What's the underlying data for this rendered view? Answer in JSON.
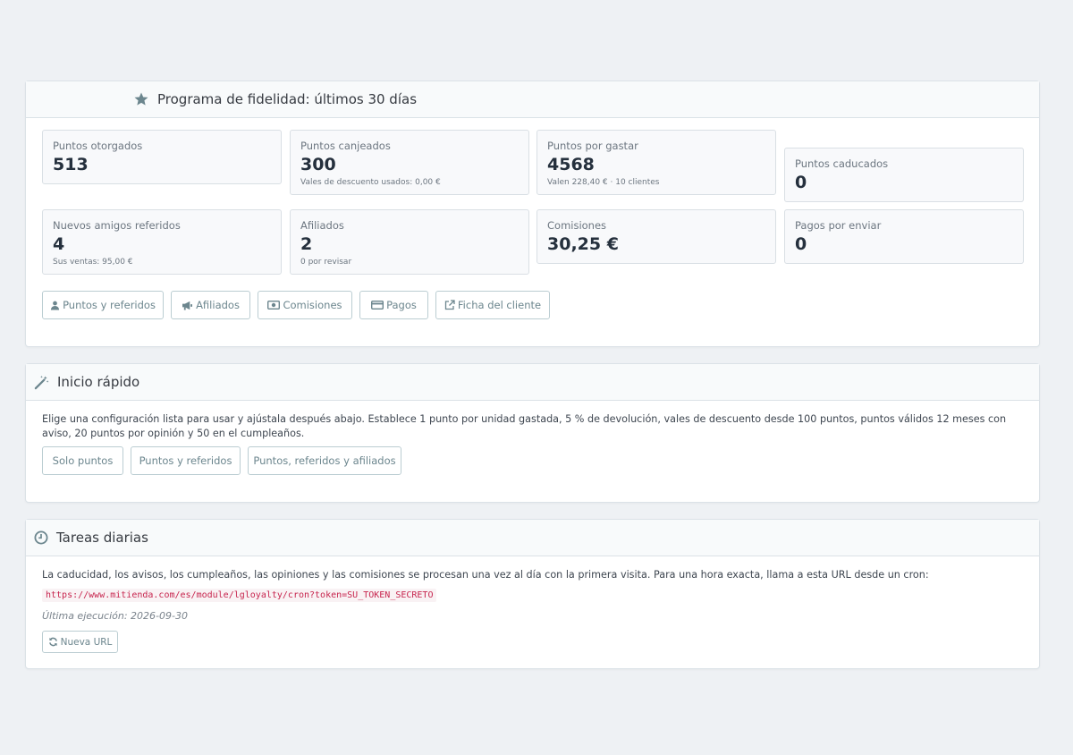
{
  "loyalty": {
    "title": "Programa de fidelidad: últimos 30 días",
    "heading_icon": "star-icon",
    "stats": [
      {
        "label": "Puntos otorgados",
        "value": "513",
        "sub": ""
      },
      {
        "label": "Puntos canjeados",
        "value": "300",
        "sub": "Vales de descuento usados: 0,00 €"
      },
      {
        "label": "Puntos por gastar",
        "value": "4568",
        "sub": "Valen 228,40 € · 10 clientes"
      },
      {
        "label": "Puntos caducados",
        "value": "0",
        "sub": ""
      },
      {
        "label": "Nuevos amigos referidos",
        "value": "4",
        "sub": "Sus ventas: 95,00 €"
      },
      {
        "label": "Afiliados",
        "value": "2",
        "sub": "0 por revisar"
      },
      {
        "label": "Comisiones",
        "value": "30,25 €",
        "sub": ""
      },
      {
        "label": "Pagos por enviar",
        "value": "0",
        "sub": ""
      }
    ],
    "buttons": [
      {
        "label": "Puntos y referidos",
        "icon": "user-icon"
      },
      {
        "label": "Afiliados",
        "icon": "bullhorn-icon"
      },
      {
        "label": "Comisiones",
        "icon": "money-icon"
      },
      {
        "label": "Pagos",
        "icon": "credit-card-icon"
      },
      {
        "label": "Ficha del cliente",
        "icon": "external-link-icon"
      }
    ]
  },
  "quick_start": {
    "title": "Inicio rápido",
    "heading_icon": "magic-wand-icon",
    "description": "Elige una configuración lista para usar y ajústala después abajo. Establece 1 punto por unidad gastada, 5 % de devolución, vales de descuento desde 100 puntos, puntos válidos 12 meses con aviso, 20 puntos por opinión y 50 en el cumpleaños.",
    "buttons": [
      "Solo puntos",
      "Puntos y referidos",
      "Puntos, referidos y afiliados"
    ]
  },
  "daily_tasks": {
    "title": "Tareas diarias",
    "heading_icon": "clock-icon",
    "description": "La caducidad, los avisos, los cumpleaños, las opiniones y las comisiones se procesan una vez al día con la primera visita. Para una hora exacta, llama a esta URL desde un cron:",
    "cron_url": "https://www.mitienda.com/es/module/lgloyalty/cron?token=SU_TOKEN_SECRETO",
    "last_run": "Última ejecución: 2026-09-30",
    "new_url_button": "Nueva URL",
    "new_url_icon": "refresh-icon"
  },
  "colors": {
    "background": "#eef1f4",
    "panel_heading": "#f8fafb",
    "button_text": "#6c868e",
    "button_border": "#bbcdd2",
    "code_text": "#c7254e"
  }
}
